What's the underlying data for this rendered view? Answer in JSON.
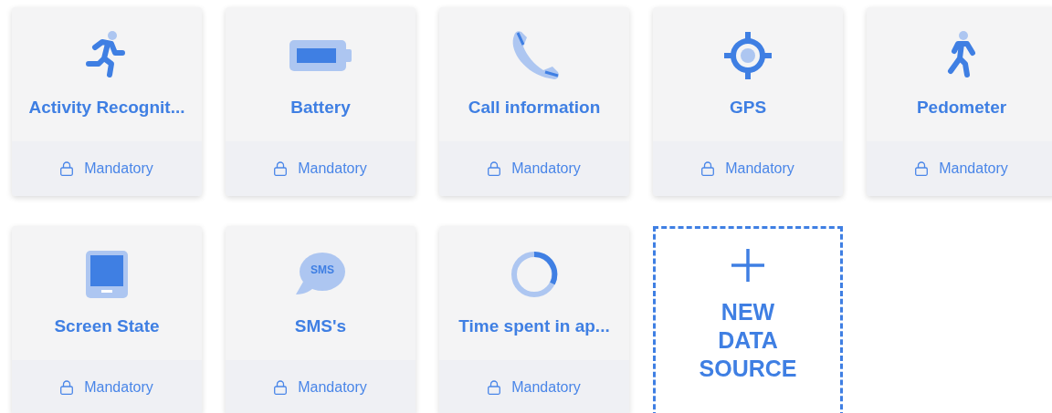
{
  "cards": [
    {
      "kind": "source",
      "title": "Activity Recognit...",
      "footer": "Mandatory"
    },
    {
      "kind": "source",
      "title": "Battery",
      "footer": "Mandatory"
    },
    {
      "kind": "source",
      "title": "Call information",
      "footer": "Mandatory"
    },
    {
      "kind": "source",
      "title": "GPS",
      "footer": "Mandatory"
    },
    {
      "kind": "source",
      "title": "Pedometer",
      "footer": "Mandatory"
    },
    {
      "kind": "source",
      "title": "Screen State",
      "footer": "Mandatory"
    },
    {
      "kind": "source",
      "icon_text": "SMS",
      "title": "SMS's",
      "footer": "Mandatory"
    },
    {
      "kind": "source",
      "title": "Time spent in ap...",
      "footer": "Mandatory"
    },
    {
      "kind": "new",
      "title": "NEW DATA SOURCE"
    }
  ]
}
